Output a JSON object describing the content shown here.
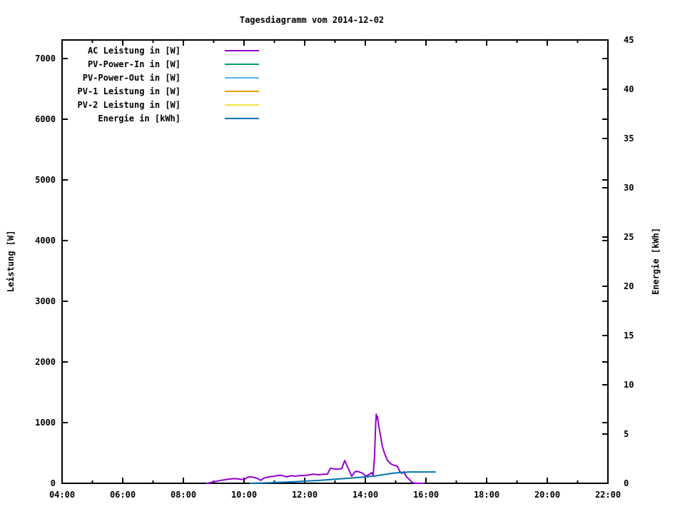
{
  "chart_data": {
    "type": "line",
    "title": "Tagesdiagramm vom 2014-12-02",
    "background": "#ffffff",
    "axis_color": "#000000",
    "grid": false,
    "legend_position": "top-left-inside",
    "x_axis": {
      "kind": "time-of-day",
      "range_hours": [
        4,
        22
      ],
      "tick_hours": [
        4,
        6,
        8,
        10,
        12,
        14,
        16,
        18,
        20,
        22
      ],
      "tick_labels": [
        "04:00",
        "06:00",
        "08:00",
        "10:00",
        "12:00",
        "14:00",
        "16:00",
        "18:00",
        "20:00",
        "22:00"
      ],
      "minor_tick_step_hours": 1
    },
    "y_left_axis": {
      "label": "Leistung [W]",
      "range": [
        0,
        7306
      ],
      "tick_values": [
        0,
        1000,
        2000,
        3000,
        4000,
        5000,
        6000,
        7000
      ],
      "tick_labels": [
        "0",
        "1000",
        "2000",
        "3000",
        "4000",
        "5000",
        "6000",
        "7000"
      ]
    },
    "y_right_axis": {
      "label": "Energie [kWh]",
      "range": [
        0,
        45
      ],
      "tick_values": [
        0,
        5,
        10,
        15,
        20,
        25,
        30,
        35,
        40,
        45
      ],
      "tick_labels": [
        "0",
        "5",
        "10",
        "15",
        "20",
        "25",
        "30",
        "35",
        "40",
        "45"
      ]
    },
    "series": [
      {
        "name": "AC Leistung in [W]",
        "color": "#9400d3",
        "axis": "left",
        "points": [
          [
            8.78,
            0
          ],
          [
            8.9,
            12
          ],
          [
            9.0,
            25
          ],
          [
            9.2,
            45
          ],
          [
            9.35,
            58
          ],
          [
            9.5,
            70
          ],
          [
            9.7,
            78
          ],
          [
            9.85,
            70
          ],
          [
            10.0,
            60
          ],
          [
            10.1,
            95
          ],
          [
            10.2,
            108
          ],
          [
            10.3,
            100
          ],
          [
            10.45,
            80
          ],
          [
            10.55,
            48
          ],
          [
            10.65,
            85
          ],
          [
            10.8,
            105
          ],
          [
            11.0,
            118
          ],
          [
            11.15,
            132
          ],
          [
            11.25,
            128
          ],
          [
            11.4,
            106
          ],
          [
            11.55,
            125
          ],
          [
            11.7,
            118
          ],
          [
            11.85,
            130
          ],
          [
            12.0,
            128
          ],
          [
            12.15,
            140
          ],
          [
            12.3,
            152
          ],
          [
            12.45,
            140
          ],
          [
            12.6,
            148
          ],
          [
            12.75,
            152
          ],
          [
            12.85,
            250
          ],
          [
            12.95,
            238
          ],
          [
            13.1,
            232
          ],
          [
            13.22,
            242
          ],
          [
            13.32,
            376
          ],
          [
            13.39,
            295
          ],
          [
            13.48,
            200
          ],
          [
            13.55,
            118
          ],
          [
            13.67,
            198
          ],
          [
            13.79,
            190
          ],
          [
            13.91,
            165
          ],
          [
            14.02,
            118
          ],
          [
            14.14,
            150
          ],
          [
            14.21,
            176
          ],
          [
            14.26,
            130
          ],
          [
            14.3,
            420
          ],
          [
            14.34,
            980
          ],
          [
            14.36,
            1140
          ],
          [
            14.38,
            1060
          ],
          [
            14.4,
            1100
          ],
          [
            14.44,
            950
          ],
          [
            14.49,
            812
          ],
          [
            14.56,
            612
          ],
          [
            14.64,
            482
          ],
          [
            14.73,
            376
          ],
          [
            14.85,
            318
          ],
          [
            14.96,
            295
          ],
          [
            15.06,
            282
          ],
          [
            15.13,
            200
          ],
          [
            15.2,
            165
          ],
          [
            15.27,
            188
          ],
          [
            15.36,
            106
          ],
          [
            15.46,
            58
          ],
          [
            15.55,
            12
          ],
          [
            15.67,
            0
          ],
          [
            15.92,
            0
          ]
        ]
      },
      {
        "name": "PV-Power-In in [W]",
        "color": "#009e73",
        "axis": "left",
        "points": []
      },
      {
        "name": "PV-Power-Out in [W]",
        "color": "#56b4e9",
        "axis": "left",
        "points": []
      },
      {
        "name": "PV-1 Leistung in [W]",
        "color": "#e69f00",
        "axis": "left",
        "points": []
      },
      {
        "name": "PV-2 Leistung in [W]",
        "color": "#f0e442",
        "axis": "left",
        "points": []
      },
      {
        "name": "Energie in [kWh]",
        "color": "#0072b2",
        "axis": "right",
        "points": [
          [
            10.2,
            0.0
          ],
          [
            10.6,
            0.03
          ],
          [
            11.0,
            0.08
          ],
          [
            11.5,
            0.14
          ],
          [
            12.0,
            0.22
          ],
          [
            12.5,
            0.3
          ],
          [
            13.0,
            0.42
          ],
          [
            13.5,
            0.52
          ],
          [
            14.0,
            0.65
          ],
          [
            14.3,
            0.73
          ],
          [
            14.5,
            0.83
          ],
          [
            14.7,
            0.93
          ],
          [
            14.9,
            1.02
          ],
          [
            15.1,
            1.08
          ],
          [
            15.3,
            1.12
          ],
          [
            15.5,
            1.15
          ],
          [
            16.3,
            1.15
          ]
        ]
      }
    ]
  }
}
